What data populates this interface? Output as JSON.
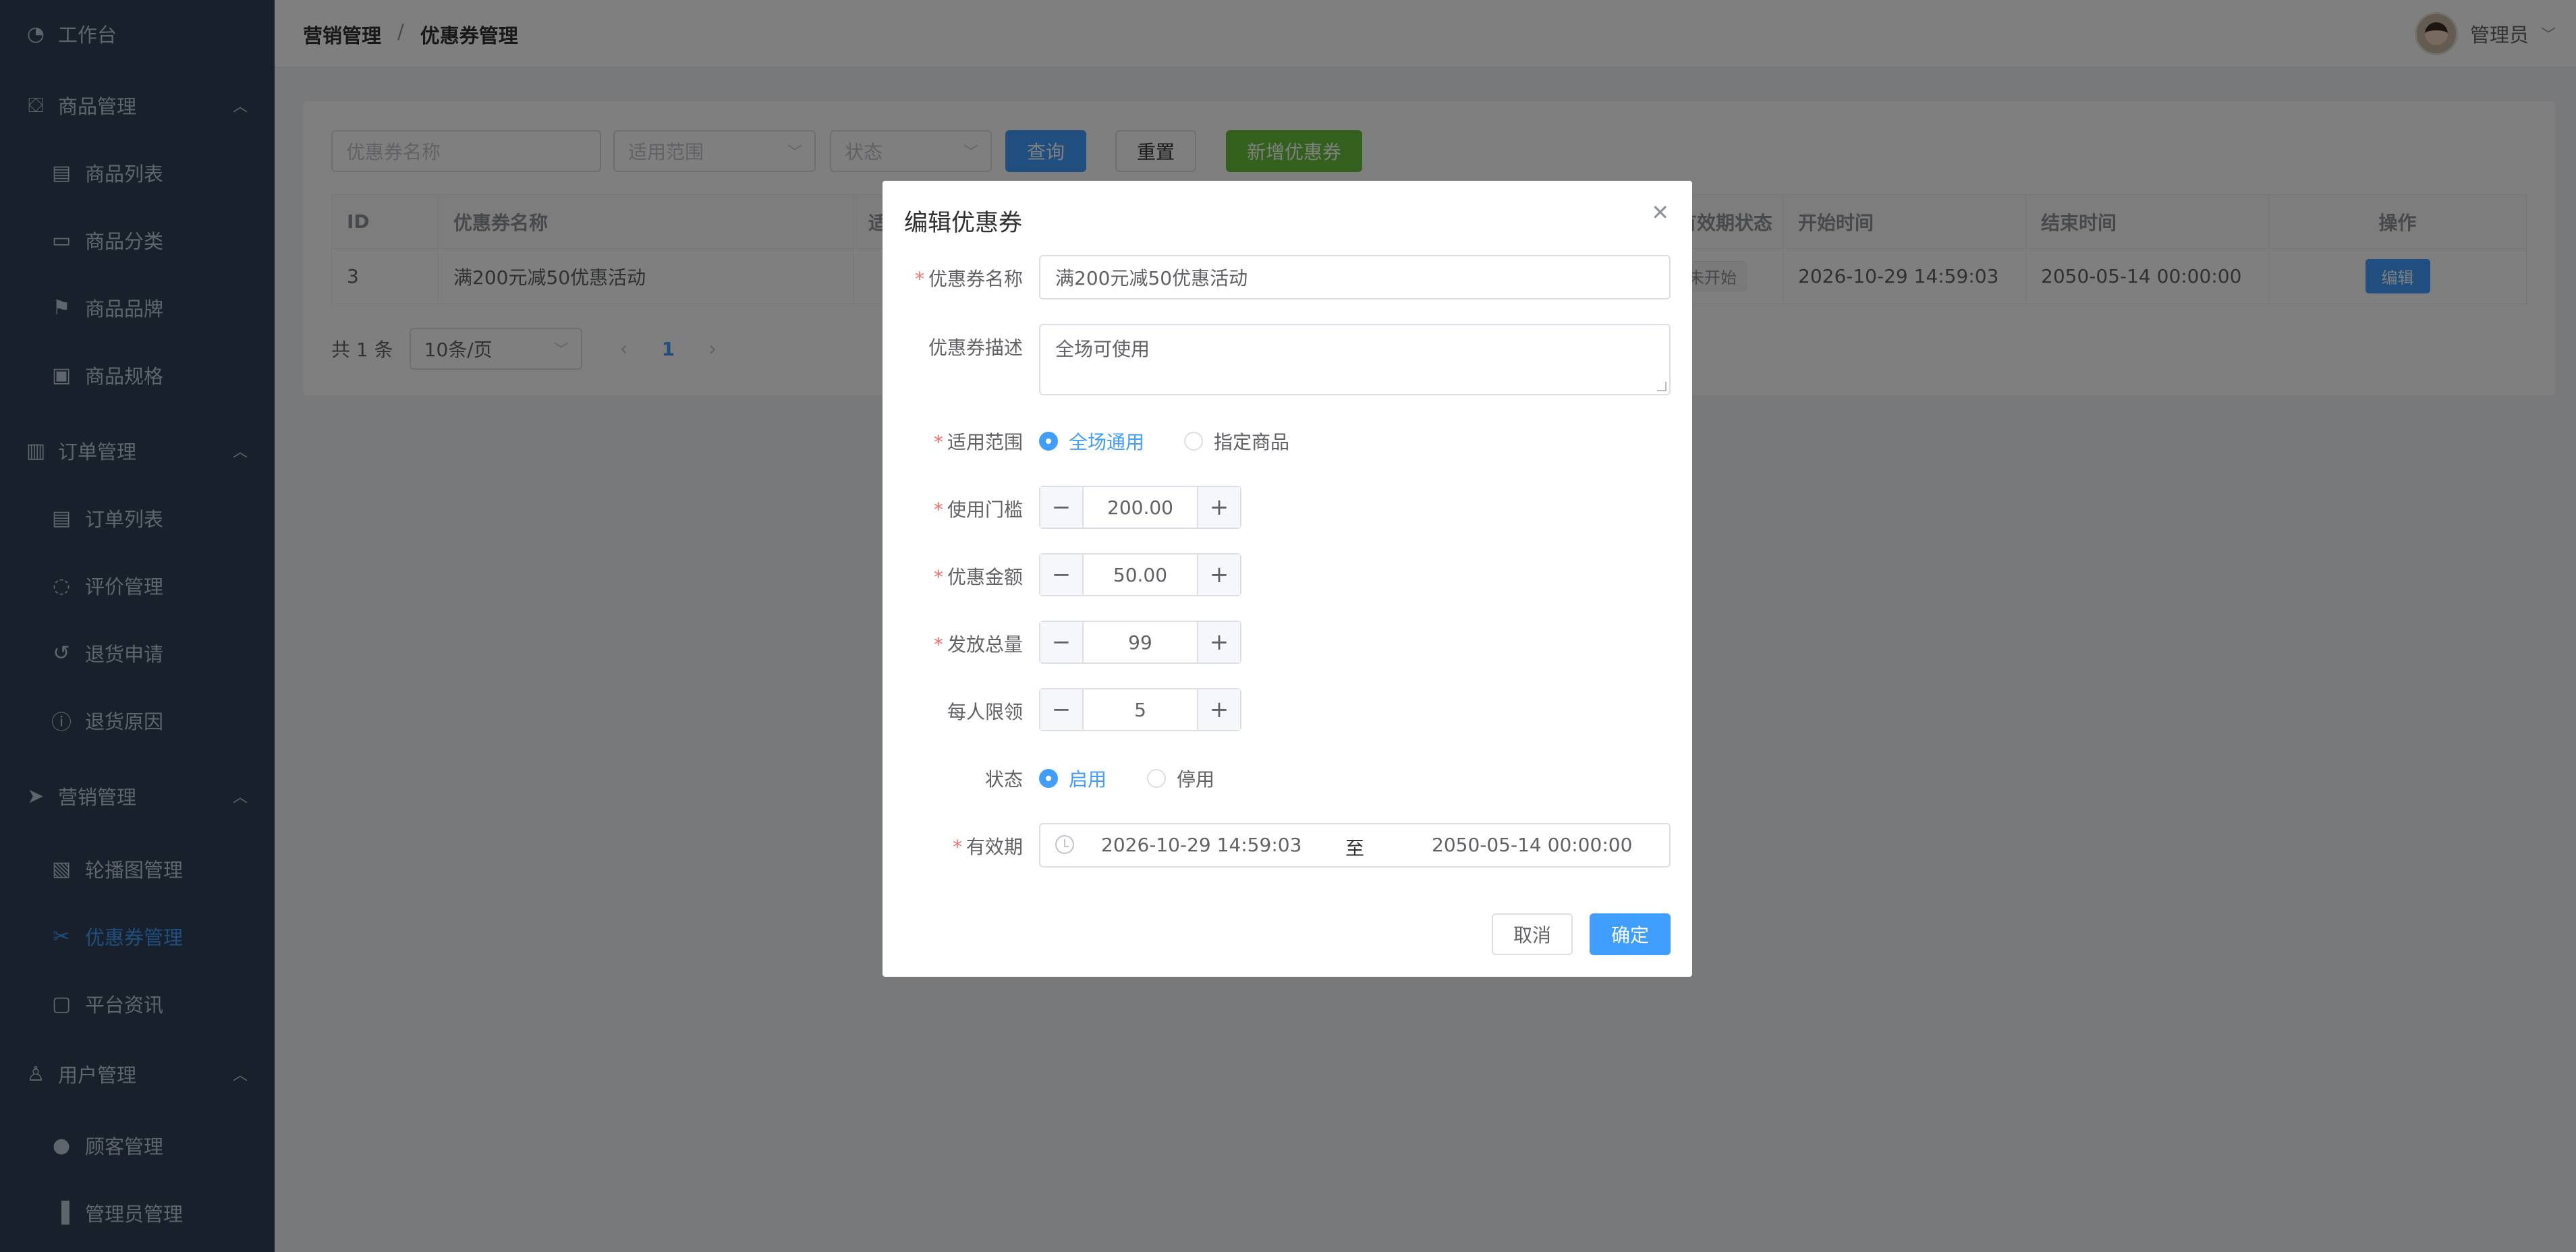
{
  "sidebar": {
    "items": [
      {
        "label": "工作台",
        "icon": "dashboard-icon",
        "glyph": "◔",
        "level": 0,
        "expandable": false
      },
      {
        "label": "商品管理",
        "icon": "bag-icon",
        "glyph": "⛋",
        "level": 0,
        "expandable": true
      },
      {
        "label": "商品列表",
        "icon": "document-icon",
        "glyph": "▤",
        "level": 1
      },
      {
        "label": "商品分类",
        "icon": "folder-icon",
        "glyph": "▭",
        "level": 1
      },
      {
        "label": "商品品牌",
        "icon": "flag-icon",
        "glyph": "⚑",
        "level": 1
      },
      {
        "label": "商品规格",
        "icon": "spec-icon",
        "glyph": "▣",
        "level": 1
      },
      {
        "label": "订单管理",
        "icon": "clipboard-icon",
        "glyph": "▥",
        "level": 0,
        "expandable": true
      },
      {
        "label": "订单列表",
        "icon": "document-icon",
        "glyph": "▤",
        "level": 1
      },
      {
        "label": "评价管理",
        "icon": "chat-icon",
        "glyph": "◌",
        "level": 1
      },
      {
        "label": "退货申请",
        "icon": "refresh-icon",
        "glyph": "↺",
        "level": 1
      },
      {
        "label": "退货原因",
        "icon": "warning-icon",
        "glyph": "ⓘ",
        "level": 1
      },
      {
        "label": "营销管理",
        "icon": "send-icon",
        "glyph": "➤",
        "level": 0,
        "expandable": true
      },
      {
        "label": "轮播图管理",
        "icon": "picture-icon",
        "glyph": "▧",
        "level": 1
      },
      {
        "label": "优惠券管理",
        "icon": "ticket-icon",
        "glyph": "✂",
        "level": 1,
        "active": true
      },
      {
        "label": "平台资讯",
        "icon": "news-icon",
        "glyph": "▢",
        "level": 1
      },
      {
        "label": "用户管理",
        "icon": "user-icon",
        "glyph": "♙",
        "level": 0,
        "expandable": true
      },
      {
        "label": "顾客管理",
        "icon": "customer-icon",
        "glyph": "●",
        "level": 1
      },
      {
        "label": "管理员管理",
        "icon": "admin-icon",
        "glyph": "▐",
        "level": 1
      }
    ]
  },
  "header": {
    "breadcrumb": [
      "营销管理",
      "优惠券管理"
    ],
    "breadcrumb_separator": "/",
    "user_name": "管理员"
  },
  "filters": {
    "name_placeholder": "优惠券名称",
    "scope_placeholder": "适用范围",
    "status_placeholder": "状态",
    "query_label": "查询",
    "reset_label": "重置",
    "add_label": "新增优惠券"
  },
  "table": {
    "columns": [
      "ID",
      "优惠券名称",
      "适",
      "有效期状态",
      "开始时间",
      "结束时间",
      "操作"
    ],
    "rows": [
      {
        "id": "3",
        "name": "满200元减50优惠活动",
        "validity": "未开始",
        "start": "2026-10-29 14:59:03",
        "end": "2050-05-14 00:00:00",
        "action": "编辑"
      }
    ]
  },
  "pagination": {
    "total": "共 1 条",
    "page_size": "10条/页",
    "current_page": "1"
  },
  "dialog": {
    "title": "编辑优惠券",
    "fields": {
      "name_label": "优惠券名称",
      "name_value": "满200元减50优惠活动",
      "desc_label": "优惠券描述",
      "desc_value": "全场可使用",
      "scope_label": "适用范围",
      "scope_options": [
        "全场通用",
        "指定商品"
      ],
      "scope_selected": 0,
      "threshold_label": "使用门槛",
      "threshold_value": "200.00",
      "amount_label": "优惠金额",
      "amount_value": "50.00",
      "total_label": "发放总量",
      "total_value": "99",
      "limit_label": "每人限领",
      "limit_value": "5",
      "status_label": "状态",
      "status_options": [
        "启用",
        "停用"
      ],
      "status_selected": 0,
      "validity_label": "有效期",
      "validity_start": "2026-10-29 14:59:03",
      "validity_separator": "至",
      "validity_end": "2050-05-14 00:00:00"
    },
    "cancel_label": "取消",
    "ok_label": "确定"
  },
  "colors": {
    "sidebar_bg": "#304156",
    "primary": "#409eff",
    "success": "#67c23a",
    "danger": "#f56c6c"
  }
}
